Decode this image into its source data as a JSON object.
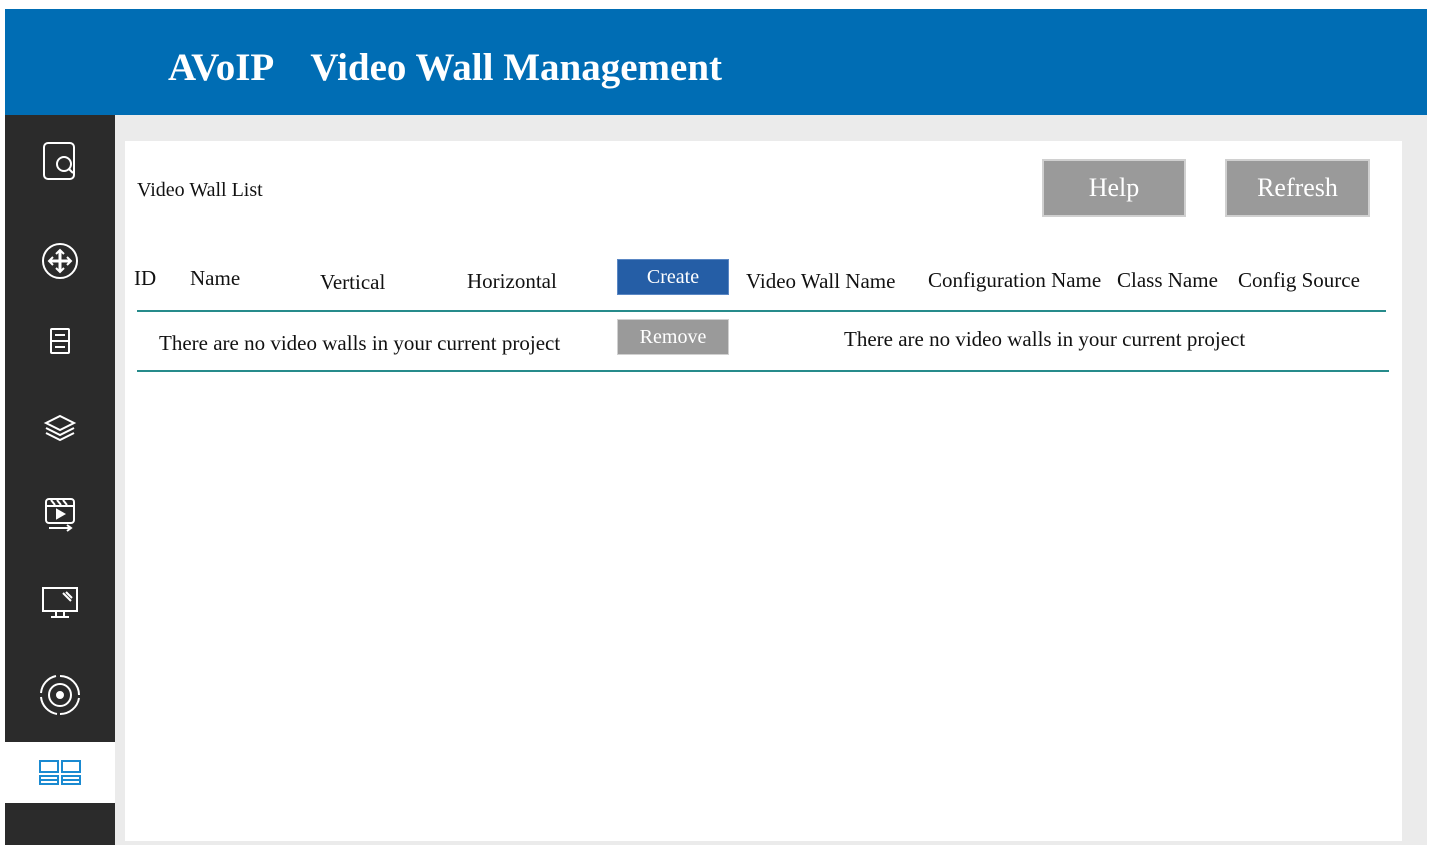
{
  "app": {
    "title": "AVoIP    Video Wall Management"
  },
  "sidebar": {
    "items": [
      {
        "icon": "screen-search-icon",
        "active": false
      },
      {
        "icon": "move-arrows-icon",
        "active": false
      },
      {
        "icon": "device-rack-icon",
        "active": false
      },
      {
        "icon": "layers-icon",
        "active": false
      },
      {
        "icon": "media-play-icon",
        "active": false
      },
      {
        "icon": "monitor-icon",
        "active": false
      },
      {
        "icon": "target-icon",
        "active": false
      },
      {
        "icon": "grid-layout-icon",
        "active": true
      }
    ],
    "active_color": "#1a8ad1"
  },
  "panel": {
    "title": "Video Wall List",
    "help_label": "Help",
    "refresh_label": "Refresh",
    "create_label": "Create",
    "remove_label": "Remove",
    "left_columns": {
      "id": "ID",
      "name": "Name",
      "vertical": "Vertical",
      "horizontal": "Horizontal"
    },
    "right_columns": {
      "video_wall_name": "Video Wall Name",
      "configuration_name": "Configuration Name",
      "class_name": "Class Name",
      "config_source": "Config Source"
    },
    "left_empty_message": "There are no video walls in your current project",
    "right_empty_message": "There are no video walls in your current project"
  },
  "colors": {
    "header": "#006db4",
    "sidebar": "#2b2b2b",
    "create_button": "#255ea6",
    "gray_button": "#9a9a9a",
    "divider": "#268b8b"
  }
}
